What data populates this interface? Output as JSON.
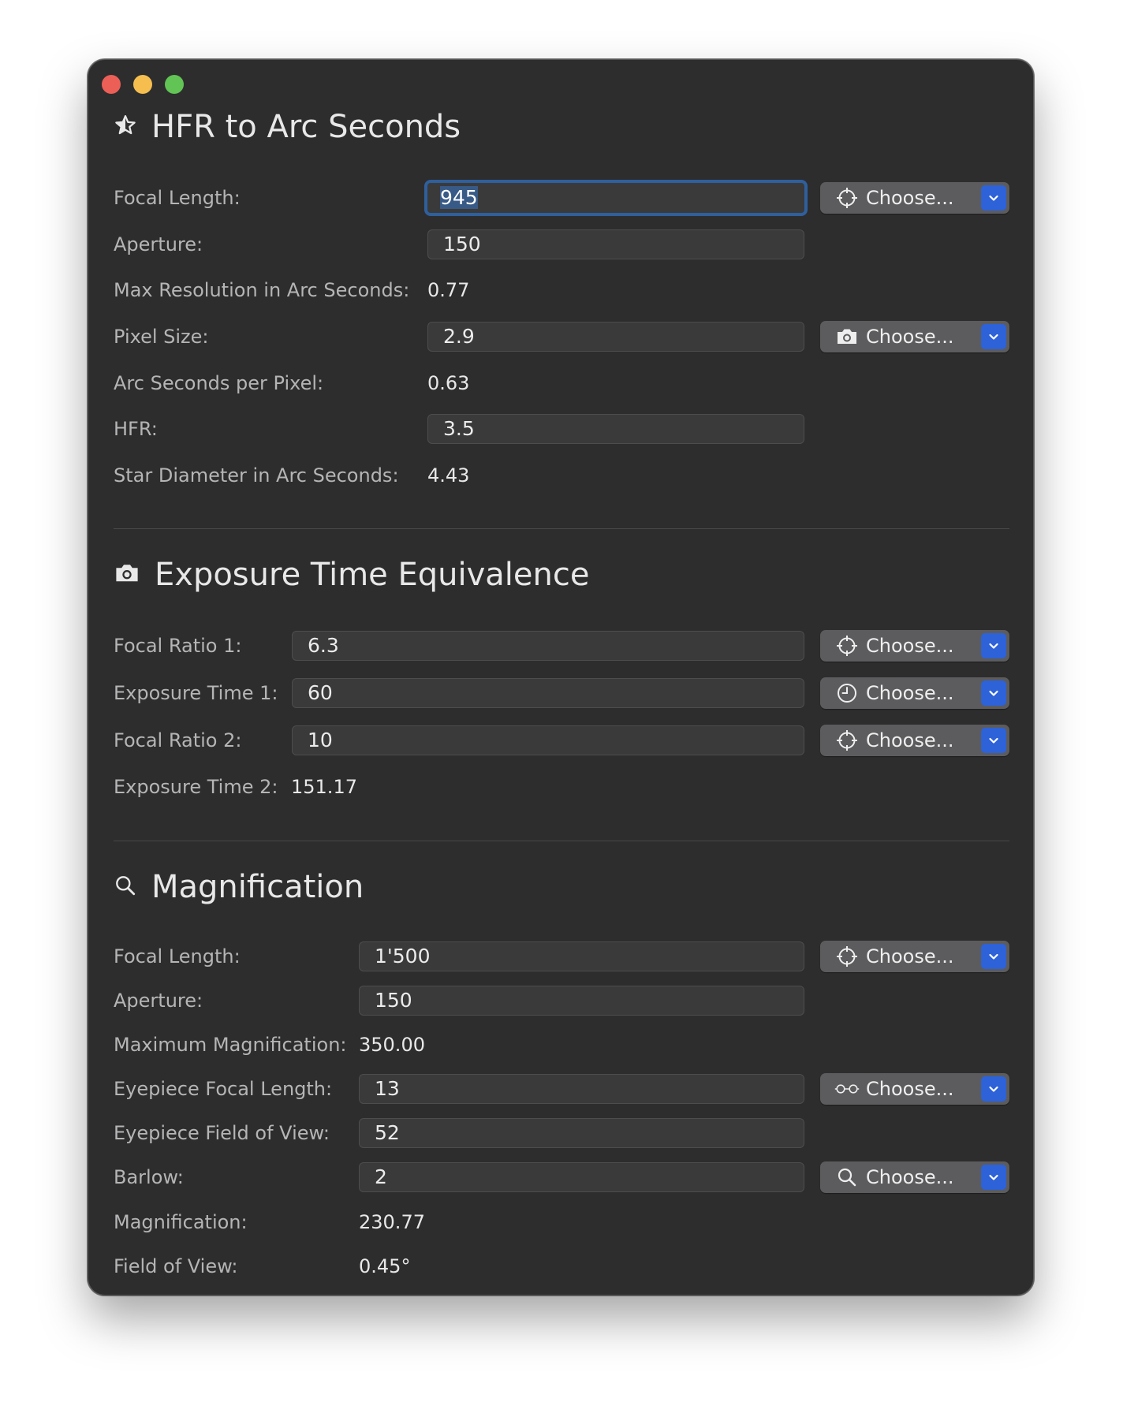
{
  "window": {
    "controls": {
      "close": "close",
      "minimize": "minimize",
      "zoom": "zoom"
    }
  },
  "hfr": {
    "title": "HFR to Arc Seconds",
    "icon": "star-icon",
    "focal_length_label": "Focal Length:",
    "focal_length_value": "945",
    "aperture_label": "Aperture:",
    "aperture_value": "150",
    "max_resolution_label": "Max Resolution in Arc Seconds:",
    "max_resolution_value": "0.77",
    "pixel_size_label": "Pixel Size:",
    "pixel_size_value": "2.9",
    "arcsec_per_pixel_label": "Arc Seconds per Pixel:",
    "arcsec_per_pixel_value": "0.63",
    "hfr_label": "HFR:",
    "hfr_value": "3.5",
    "star_diameter_label": "Star Diameter in Arc Seconds:",
    "star_diameter_value": "4.43",
    "choose_telescope_label": "Choose...",
    "choose_camera_label": "Choose..."
  },
  "exposure": {
    "title": "Exposure Time Equivalence",
    "icon": "camera-icon",
    "focal_ratio_1_label": "Focal Ratio 1:",
    "focal_ratio_1_value": "6.3",
    "exposure_time_1_label": "Exposure Time 1:",
    "exposure_time_1_value": "60",
    "focal_ratio_2_label": "Focal Ratio 2:",
    "focal_ratio_2_value": "10",
    "exposure_time_2_label": "Exposure Time 2:",
    "exposure_time_2_value": "151.17",
    "choose_ratio_1_label": "Choose...",
    "choose_time_1_label": "Choose...",
    "choose_ratio_2_label": "Choose..."
  },
  "magnification": {
    "title": "Magnification",
    "icon": "magnifier-icon",
    "focal_length_label": "Focal Length:",
    "focal_length_value": "1'500",
    "aperture_label": "Aperture:",
    "aperture_value": "150",
    "max_magnification_label": "Maximum Magnification:",
    "max_magnification_value": "350.00",
    "eyepiece_focal_length_label": "Eyepiece Focal Length:",
    "eyepiece_focal_length_value": "13",
    "eyepiece_fov_label": "Eyepiece Field of View:",
    "eyepiece_fov_value": "52",
    "barlow_label": "Barlow:",
    "barlow_value": "2",
    "magnification_label": "Magnification:",
    "magnification_value": "230.77",
    "field_of_view_label": "Field of View:",
    "field_of_view_value": "0.45°",
    "choose_telescope_label": "Choose...",
    "choose_eyepiece_label": "Choose...",
    "choose_barlow_label": "Choose..."
  },
  "colors": {
    "window_bg": "#2d2d2e",
    "field_bg": "#3a3a3b",
    "button_bg": "#5c5c5e",
    "accent": "#2d62d8",
    "focus_ring": "#2f5f9c"
  }
}
